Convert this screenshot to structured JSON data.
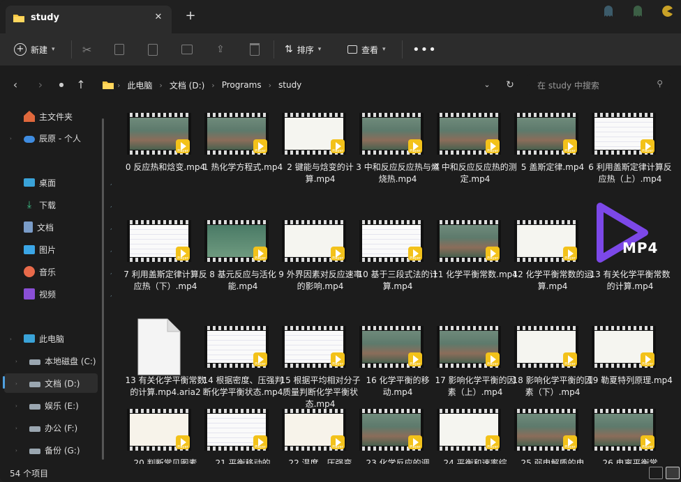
{
  "tab": {
    "title": "study"
  },
  "toolbar": {
    "new_label": "新建",
    "sort_label": "排序",
    "view_label": "查看"
  },
  "address": {
    "crumbs": [
      "此电脑",
      "文档 (D:)",
      "Programs",
      "study"
    ],
    "search_placeholder": "在 study 中搜索"
  },
  "sidebar": {
    "items": [
      {
        "label": "主文件夹"
      },
      {
        "label": "辰原 - 个人"
      },
      {
        "label": "桌面"
      },
      {
        "label": "下载"
      },
      {
        "label": "文档"
      },
      {
        "label": "图片"
      },
      {
        "label": "音乐"
      },
      {
        "label": "视频"
      },
      {
        "label": "此电脑"
      },
      {
        "label": "本地磁盘 (C:)"
      },
      {
        "label": "文档 (D:)"
      },
      {
        "label": "娱乐 (E:)"
      },
      {
        "label": "办公 (F:)"
      },
      {
        "label": "备份 (G:)"
      }
    ]
  },
  "files": [
    {
      "name": "0 反应热和焓变.mp4",
      "thumb": "video"
    },
    {
      "name": "1 热化学方程式.mp4",
      "thumb": "video"
    },
    {
      "name": "2 键能与焓变的计算.mp4",
      "thumb": "white"
    },
    {
      "name": "3 中和反应反应热与燃烧热.mp4",
      "thumb": "video"
    },
    {
      "name": "4 中和反应反应热的测定.mp4",
      "thumb": "video"
    },
    {
      "name": "5 盖斯定律.mp4",
      "thumb": "video"
    },
    {
      "name": "6 利用盖斯定律计算反应热（上）.mp4",
      "thumb": "doc"
    },
    {
      "name": "7 利用盖斯定律计算反应热（下）.mp4",
      "thumb": "doc"
    },
    {
      "name": "8 基元反应与活化能.mp4",
      "thumb": "green"
    },
    {
      "name": "9 外界因素对反应速率的影响.mp4",
      "thumb": "white"
    },
    {
      "name": "10 基于三段式法的计算.mp4",
      "thumb": "doc"
    },
    {
      "name": "11 化学平衡常数.mp4",
      "thumb": "video"
    },
    {
      "name": "12 化学平衡常数的运算.mp4",
      "thumb": "white"
    },
    {
      "name": "13 有关化学平衡常数的计算.mp4",
      "thumb": "mp4"
    },
    {
      "name": "13 有关化学平衡常数的计算.mp4.aria2",
      "thumb": "file"
    },
    {
      "name": "14 根据密度、压强判断化学平衡状态.mp4",
      "thumb": "doc"
    },
    {
      "name": "15 根据平均相对分子质量判断化学平衡状态.mp4",
      "thumb": "doc"
    },
    {
      "name": "16 化学平衡的移动.mp4",
      "thumb": "video"
    },
    {
      "name": "17 影响化学平衡的因素（上）.mp4",
      "thumb": "video"
    },
    {
      "name": "18 影响化学平衡的因素（下）.mp4",
      "thumb": "white"
    },
    {
      "name": "19 勒夏特列原理.mp4",
      "thumb": "white"
    },
    {
      "name": "20 判断常见图素",
      "thumb": "cartoon"
    },
    {
      "name": "21 平衡移动的",
      "thumb": "doc"
    },
    {
      "name": "22 温度、压强变",
      "thumb": "cartoon"
    },
    {
      "name": "23 化学反应的调",
      "thumb": "video"
    },
    {
      "name": "24 平衡和速率综",
      "thumb": "white"
    },
    {
      "name": "25 弱电解质的电",
      "thumb": "video"
    },
    {
      "name": "26 电离平衡常",
      "thumb": "video"
    }
  ],
  "status": {
    "count": "54 个项目"
  },
  "badge_label": "Player",
  "mp4_label": "MP4"
}
